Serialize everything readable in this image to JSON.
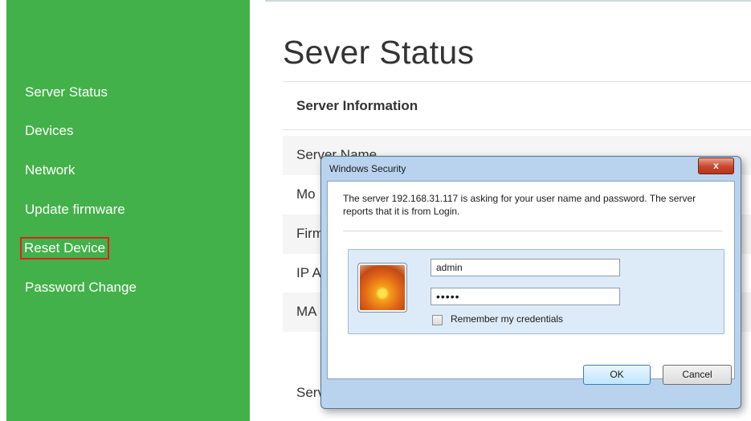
{
  "sidebar": {
    "items": [
      {
        "label": "Server Status"
      },
      {
        "label": "Devices"
      },
      {
        "label": "Network"
      },
      {
        "label": "Update firmware"
      },
      {
        "label": "Reset Device"
      },
      {
        "label": "Password Change"
      }
    ],
    "highlighted_item": "Reset Device",
    "background_color": "#43b149"
  },
  "main": {
    "title": "Sever Status",
    "section_heading": "Server Information",
    "rows": [
      {
        "label": "Server Name"
      },
      {
        "label": "Mo"
      },
      {
        "label": "Firm"
      },
      {
        "label": "IP A"
      },
      {
        "label": "MA"
      },
      {
        "label": "Serv"
      }
    ]
  },
  "dialog": {
    "title": "Windows Security",
    "close_glyph": "x",
    "message": "The server 192.168.31.117 is asking for your user name and password. The server reports that it is from Login.",
    "username_value": "admin",
    "password_value": "•••••",
    "remember_label": "Remember my credentials",
    "remember_checked": false,
    "ok_label": "OK",
    "cancel_label": "Cancel",
    "avatar_icon": "flower-user-tile-icon"
  }
}
